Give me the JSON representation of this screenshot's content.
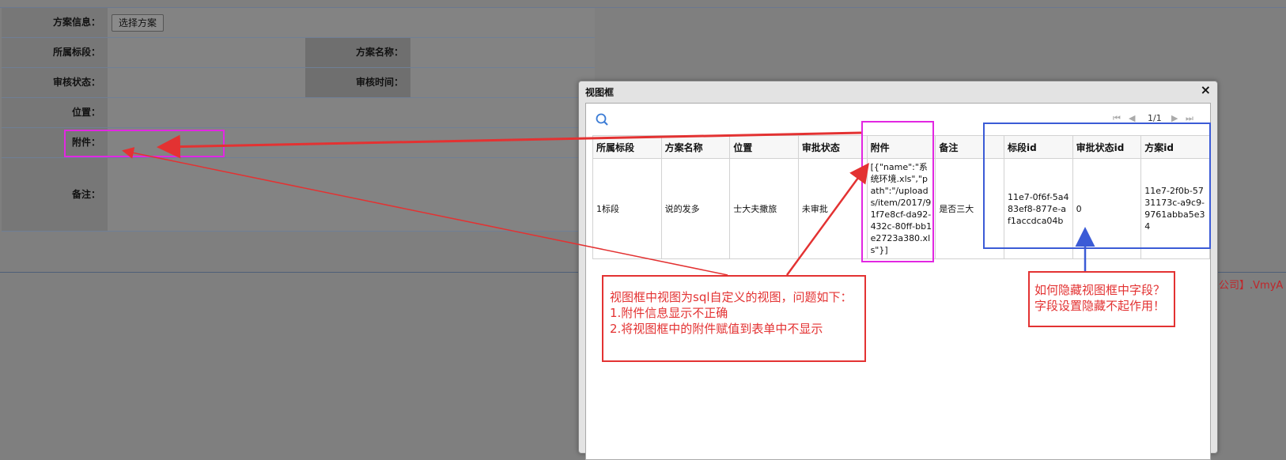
{
  "form": {
    "scheme_info_label": "方案信息：",
    "select_scheme_button": "选择方案",
    "section_label": "所属标段：",
    "scheme_name_label": "方案名称：",
    "review_status_label": "审核状态：",
    "review_time_label": "审核时间：",
    "position_label": "位置：",
    "attachment_label": "附件：",
    "remark_label": "备注："
  },
  "background_footer": "限公司】.VmyA",
  "dialog": {
    "title": "视图框",
    "close": "×",
    "pager": {
      "first": "⏮",
      "prev": "◀",
      "page": "1/1",
      "next": "▶",
      "last": "⏭"
    },
    "columns": [
      "所属标段",
      "方案名称",
      "位置",
      "审批状态",
      "附件",
      "备注",
      "标段id",
      "审批状态id",
      "方案id"
    ],
    "rows": [
      {
        "section": "1标段",
        "scheme_name": "说的发多",
        "position": "士大夫撒旅",
        "status": "未审批",
        "attachment": "[{\"name\":\"系统环境.xls\",\"path\":\"/uploads/item/2017/91f7e8cf-da92-432c-80ff-bb1e2723a380.xls\"}]",
        "remark": "是否三大",
        "section_id": "11e7-0f6f-5a483ef8-877e-af1accdca04b",
        "status_id": "0",
        "scheme_id": "11e7-2f0b-5731173c-a9c9-9761abba5e34"
      }
    ]
  },
  "annotations": {
    "left_note": [
      "视图框中视图为sql自定义的视图，问题如下：",
      "1.附件信息显示不正确",
      "2.将视图框中的附件赋值到表单中不显示"
    ],
    "right_note": [
      "如何隐藏视图框中字段？",
      "字段设置隐藏不起作用！"
    ],
    "colors": {
      "magenta": "#e227e2",
      "blue": "#3b5bd6",
      "red": "#e33232"
    }
  }
}
